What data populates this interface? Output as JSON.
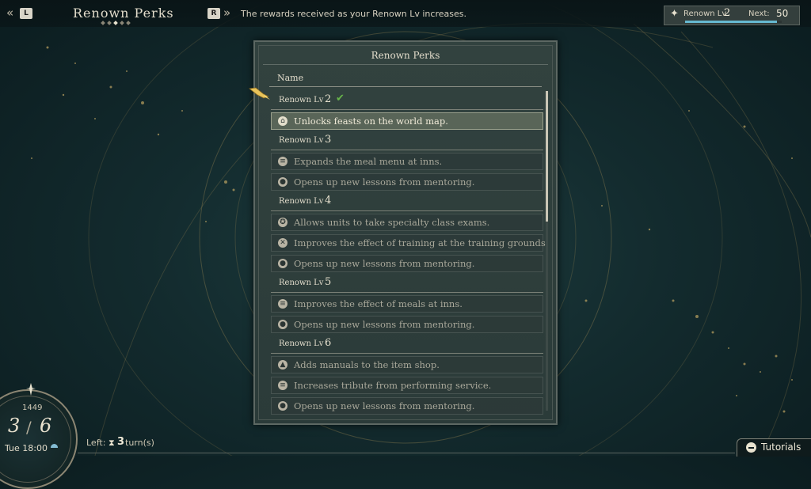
{
  "header": {
    "left_key": "L",
    "right_key": "R",
    "left_chevron": "«",
    "right_chevron": "»",
    "title": "Renown Perks",
    "page_dots": 5,
    "active_dot": 2,
    "subtitle": "The rewards received as your Renown Lv increases."
  },
  "renown": {
    "label": "Renown Lv",
    "level": "2",
    "next_label": "Next:",
    "next_value": "50",
    "progress_fraction": 0.95,
    "bar_color": "#66b9d1"
  },
  "panel": {
    "title": "Renown Perks",
    "column_name": "Name",
    "groups": [
      {
        "label": "Renown Lv",
        "level": "2",
        "unlocked": true,
        "check": "✔",
        "perks": [
          {
            "text": "Unlocks feasts on the world map.",
            "icon": "feast-icon",
            "glyph": "⌂",
            "selected": true
          }
        ]
      },
      {
        "label": "Renown Lv",
        "level": "3",
        "unlocked": false,
        "perks": [
          {
            "text": "Expands the meal menu at inns.",
            "icon": "meal-icon",
            "glyph": "≡",
            "selected": false
          },
          {
            "text": "Opens up new lessons from mentoring.",
            "icon": "mentor-icon",
            "glyph": "●",
            "selected": false
          }
        ]
      },
      {
        "label": "Renown Lv",
        "level": "4",
        "unlocked": false,
        "perks": [
          {
            "text": "Allows units to take specialty class exams.",
            "icon": "exam-icon",
            "glyph": "✪",
            "selected": false
          },
          {
            "text": "Improves the effect of training at the training grounds.",
            "icon": "training-icon",
            "glyph": "✕",
            "selected": false
          },
          {
            "text": "Opens up new lessons from mentoring.",
            "icon": "mentor-icon",
            "glyph": "●",
            "selected": false
          }
        ]
      },
      {
        "label": "Renown Lv",
        "level": "5",
        "unlocked": false,
        "perks": [
          {
            "text": "Improves the effect of meals at inns.",
            "icon": "meal-icon",
            "glyph": "≡",
            "selected": false
          },
          {
            "text": "Opens up new lessons from mentoring.",
            "icon": "mentor-icon",
            "glyph": "●",
            "selected": false
          }
        ]
      },
      {
        "label": "Renown Lv",
        "level": "6",
        "unlocked": false,
        "perks": [
          {
            "text": "Adds manuals to the item shop.",
            "icon": "shop-icon",
            "glyph": "▲",
            "selected": false
          },
          {
            "text": "Increases tribute from performing service.",
            "icon": "tribute-icon",
            "glyph": "≡",
            "selected": false
          },
          {
            "text": "Opens up new lessons from mentoring.",
            "icon": "mentor-icon",
            "glyph": "●",
            "selected": false
          }
        ]
      }
    ]
  },
  "calendar": {
    "year": "1449",
    "current": "3",
    "slash": "/",
    "total": "6",
    "day": "Tue 18:00",
    "left_label": "Left:",
    "hourglass": "⧗",
    "turns": "3",
    "turns_unit": "turn(s)"
  },
  "tutorials": {
    "label": "Tutorials"
  },
  "colors": {
    "check": "#67b54a",
    "accent_gold": "#e8c35a"
  }
}
